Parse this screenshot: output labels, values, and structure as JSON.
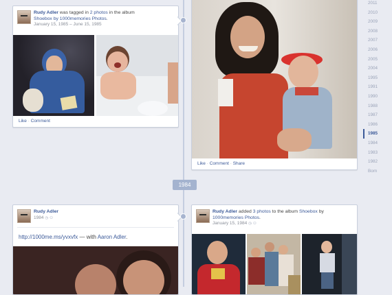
{
  "card_tagged": {
    "author": "Rudy Adler",
    "text_1": " was tagged in ",
    "photo_count": "2 photos",
    "text_2": " in the album",
    "album": "Shoebox by 1000memories Photos",
    "text_3": ".",
    "date": "January 15, 1985 – June 15, 1985",
    "actions": {
      "like": "Like",
      "sep": " · ",
      "comment": "Comment"
    }
  },
  "card_large_photo": {
    "actions": {
      "like": "Like",
      "sep1": " · ",
      "comment": "Comment",
      "sep2": " · ",
      "share": "Share"
    }
  },
  "timeline": {
    "year_marker": "1984",
    "years": [
      "2011",
      "2010",
      "2009",
      "2008",
      "2007",
      "2006",
      "2005",
      "2004",
      "1995",
      "1991",
      "1990",
      "1988",
      "1987",
      "1986",
      "1985",
      "1984",
      "1983",
      "1982",
      "Born"
    ],
    "active_year": "1985"
  },
  "card_link": {
    "author": "Rudy Adler",
    "date": "1984",
    "url": "http://1000me.ms/yvxvfx",
    "with_text": " — with ",
    "with_name": "Aaron Adler",
    "end": "."
  },
  "card_album": {
    "author": "Rudy Adler",
    "text_1": " added ",
    "photo_count": "3 photos",
    "text_2": " to the album ",
    "album_1": "Shoebox",
    "text_3": " by ",
    "album_2": "1000memories Photos",
    "text_4": ".",
    "date": "January 15, 1984"
  },
  "colors": {
    "link": "#3b5998",
    "spine": "#c4cde0",
    "background": "#e9ebf2"
  }
}
